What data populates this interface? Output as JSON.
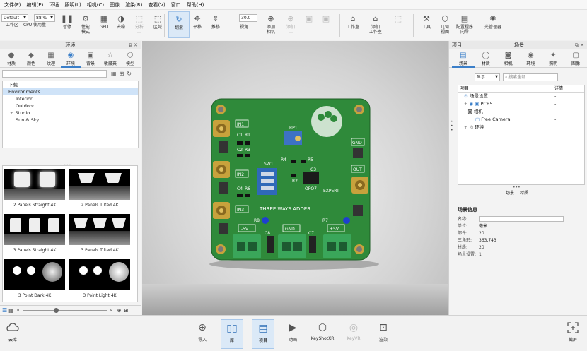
{
  "menu": [
    "文件(F)",
    "编辑(E)",
    "环境",
    "照明(L)",
    "相机(C)",
    "图像",
    "渲染(R)",
    "查看(V)",
    "窗口",
    "帮助(H)"
  ],
  "toolbar": {
    "mode_select": "Default",
    "zoom_select": "88 %",
    "fov_value": "30.0",
    "buttons": [
      {
        "label": "工作区"
      },
      {
        "label": "CPU 使用量"
      },
      {
        "label": "暂停"
      },
      {
        "label": "性能\n模式"
      },
      {
        "label": "GPU"
      },
      {
        "label": "去噪"
      },
      {
        "label": "分析\n…"
      },
      {
        "label": "区域"
      },
      {
        "label": "翻滚"
      },
      {
        "label": "平移"
      },
      {
        "label": "推移"
      },
      {
        "label": "视角"
      },
      {
        "label": "添加\n相机"
      },
      {
        "label": "添加\n…"
      },
      {
        "label": "…"
      },
      {
        "label": "…"
      },
      {
        "label": "工作室"
      },
      {
        "label": "添加\n工作室"
      },
      {
        "label": "…"
      },
      {
        "label": "工具"
      },
      {
        "label": "几何\n视图"
      },
      {
        "label": "配置程序\n向导"
      },
      {
        "label": "光管理器"
      }
    ]
  },
  "left_panel": {
    "title": "环境",
    "tabs": [
      "材质",
      "颜色",
      "纹理",
      "环境",
      "背景",
      "收藏夹",
      "模型"
    ],
    "active_tab": "环境",
    "search_placeholder": "",
    "tree": [
      "下载",
      "Environments",
      "Interior",
      "Outdoor",
      "Studio",
      "Sun & Sky"
    ],
    "thumbnails": [
      "2 Panels Straight 4K",
      "2 Panels Tilted 4K",
      "3 Panels Straight 4K",
      "3 Panels Tilted 4K",
      "3 Point Dark 4K",
      "3 Point Light 4K"
    ]
  },
  "right_panel": {
    "title": "项目",
    "header": "场景",
    "tabs": [
      "场景",
      "材质",
      "相机",
      "环境",
      "照明",
      "图像"
    ],
    "active_tab": "场景",
    "filter_label": "显示",
    "search_placeholder": "搜索全部",
    "tree_columns": [
      "项目",
      "详情"
    ],
    "tree": [
      {
        "label": "场景设置",
        "detail": "-"
      },
      {
        "label": "PCB5",
        "detail": "-"
      },
      {
        "label": "相机",
        "detail": ""
      },
      {
        "label": "Free Camera",
        "detail": "-"
      },
      {
        "label": "环境",
        "detail": ""
      }
    ],
    "subtabs": [
      "场景",
      "材质"
    ],
    "info": {
      "title": "场景信息",
      "rows": [
        {
          "key": "名称:",
          "value": ""
        },
        {
          "key": "单位:",
          "value": "毫米"
        },
        {
          "key": "部件:",
          "value": "20"
        },
        {
          "key": "三角形:",
          "value": "363,743"
        },
        {
          "key": "材质:",
          "value": "20"
        },
        {
          "key": "场景设置:",
          "value": "1"
        }
      ]
    }
  },
  "pcb": {
    "labels": [
      "IN1",
      "C1",
      "R1",
      "C2",
      "R3",
      "IN2",
      "C4",
      "R6",
      "IN3",
      "RP1",
      "SW1",
      "R4",
      "R5",
      "C3",
      "R2",
      "OPO7",
      "GND",
      "OUT",
      "R8",
      "R7",
      "THREE WAYS ADDER",
      "-5V",
      "GND",
      "+5V",
      "EXPERT",
      "C8",
      "C7"
    ]
  },
  "bottombar": {
    "left": "云库",
    "buttons": [
      "导入",
      "库",
      "项目",
      "动画",
      "KeyShotXR",
      "KeyVR",
      "渲染"
    ],
    "active": "库",
    "right": "截屏"
  },
  "colors": {
    "accent": "#3b7fc9",
    "pcb_green": "#2f8a3a",
    "connector_green": "#3aa65a",
    "gold": "#c8a23c"
  }
}
